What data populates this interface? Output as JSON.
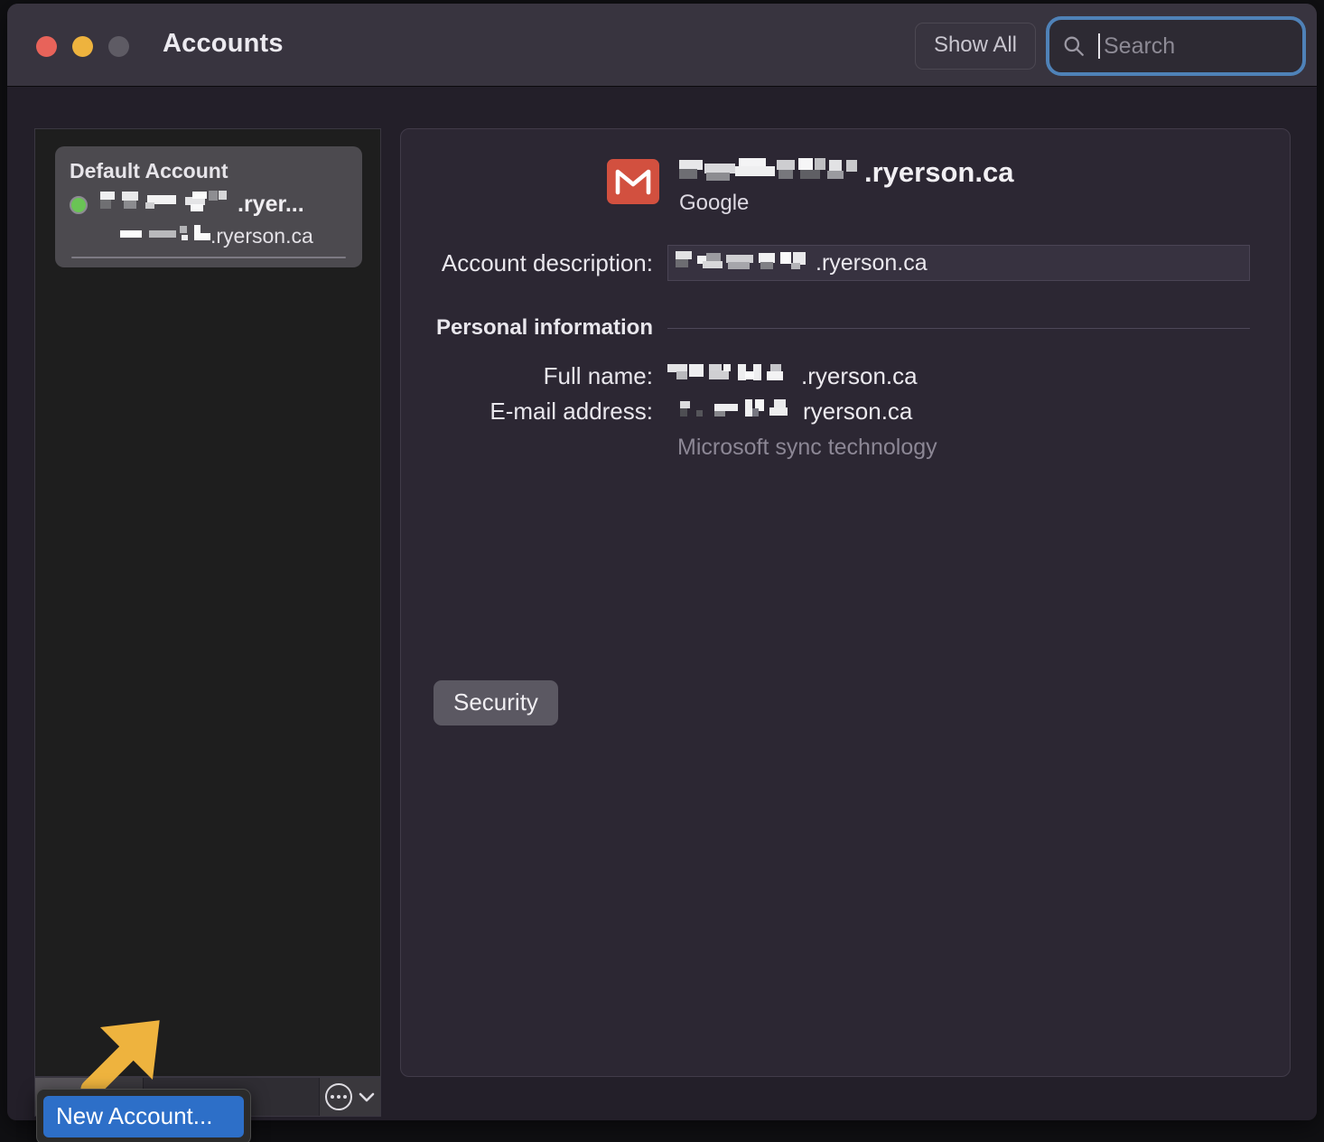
{
  "window": {
    "title": "Accounts",
    "traffic_lights": [
      "close-red",
      "minimize-yellow",
      "zoom-gray"
    ],
    "show_all_label": "Show All",
    "search": {
      "placeholder": "Search",
      "value": "",
      "icon": "search-icon",
      "focused": true,
      "focus_ring_color": "#4f82b8"
    }
  },
  "sidebar": {
    "account_card": {
      "group_label": "Default Account",
      "status": "online",
      "status_color": "#6ac455",
      "name_redacted": true,
      "name_suffix": ".ryer...",
      "sub_redacted": true,
      "sub_suffix": ".ryerson.ca"
    },
    "toolbar": {
      "add_label": "+",
      "add_icon": "plus-icon",
      "add_menu_icon": "chevron-down-icon",
      "remove_label": "−",
      "remove_icon": "minus-icon",
      "more_icon": "ellipsis-circle-icon",
      "more_menu_icon": "chevron-down-icon"
    }
  },
  "annotation": {
    "arrow_color": "#eeb33e",
    "arrow_direction": "down-left",
    "points_at": "add-account-button"
  },
  "context_menu": {
    "items": [
      {
        "label": "New Account...",
        "highlighted": true
      }
    ],
    "highlight_color": "#2d6fc8"
  },
  "detail": {
    "header": {
      "icon": "gmail-icon",
      "icon_color": "#d2503f",
      "title_suffix": ".ryerson.ca",
      "title_redacted": true,
      "provider": "Google"
    },
    "fields": [
      {
        "label": "Account description:",
        "value_suffix": ".ryerson.ca",
        "value_redacted": true,
        "is_input": true
      }
    ],
    "section": {
      "title": "Personal information"
    },
    "personal": [
      {
        "label": "Full name:",
        "value_suffix": ".ryerson.ca",
        "value_redacted": true
      },
      {
        "label": "E-mail address:",
        "value_suffix": "ryerson.ca",
        "value_redacted": true
      }
    ],
    "note": "Microsoft sync technology",
    "security_button": "Security"
  }
}
